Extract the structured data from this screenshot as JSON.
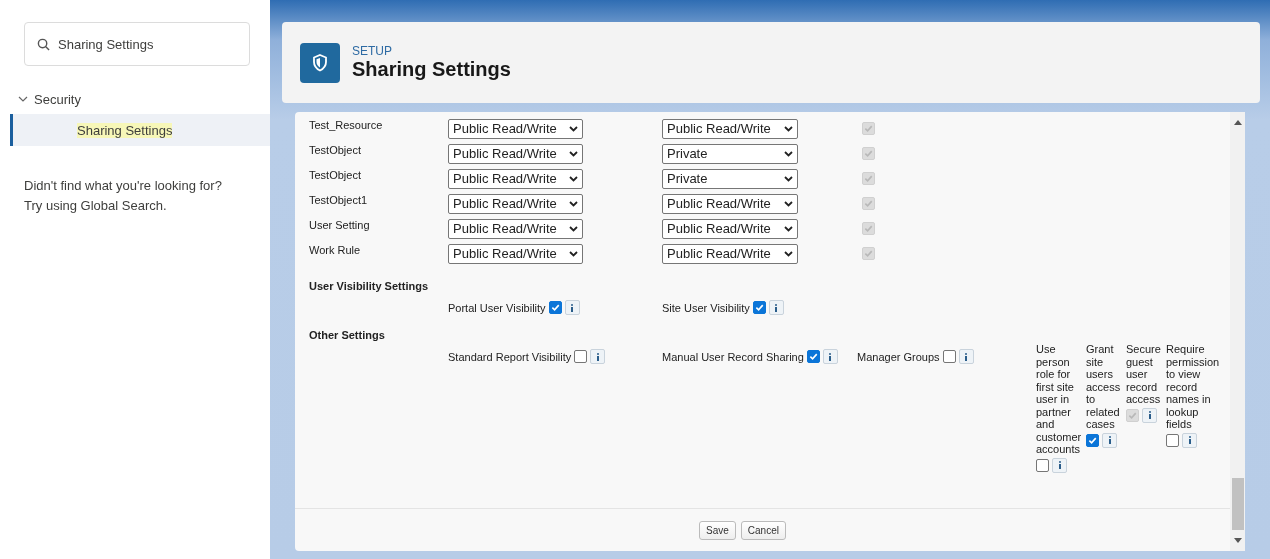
{
  "sidebar": {
    "search": {
      "value": "Sharing Settings"
    },
    "tree": [
      {
        "label": "Security",
        "expanded": true,
        "children": [
          {
            "label": "Sharing Settings",
            "selected": true
          }
        ]
      }
    ],
    "help_lines": [
      "Didn't find what you're looking for?",
      "Try using Global Search."
    ]
  },
  "header": {
    "eyebrow": "SETUP",
    "title": "Sharing Settings"
  },
  "objects": [
    {
      "name": "Test_Resource",
      "internal": "Public Read/Write",
      "external": "Public Read/Write",
      "hierarchy": {
        "checked": true,
        "disabled": true
      }
    },
    {
      "name": "TestObject",
      "internal": "Public Read/Write",
      "external": "Private",
      "hierarchy": {
        "checked": true,
        "disabled": true
      }
    },
    {
      "name": "TestObject",
      "internal": "Public Read/Write",
      "external": "Private",
      "hierarchy": {
        "checked": true,
        "disabled": true
      }
    },
    {
      "name": "TestObject1",
      "internal": "Public Read/Write",
      "external": "Public Read/Write",
      "hierarchy": {
        "checked": true,
        "disabled": true
      }
    },
    {
      "name": "User Setting",
      "internal": "Public Read/Write",
      "external": "Public Read/Write",
      "hierarchy": {
        "checked": true,
        "disabled": true
      }
    },
    {
      "name": "Work Rule",
      "internal": "Public Read/Write",
      "external": "Public Read/Write",
      "hierarchy": {
        "checked": true,
        "disabled": true
      }
    }
  ],
  "sections": [
    {
      "title": "User Visibility Settings",
      "settings": [
        {
          "kind": "inline",
          "label": "Portal User Visibility",
          "checked": true,
          "disabled": false
        },
        {
          "kind": "inline",
          "label": "Site User Visibility",
          "checked": true,
          "disabled": false
        }
      ]
    },
    {
      "title": "Other Settings",
      "settings": [
        {
          "kind": "inline",
          "label": "Standard Report Visibility",
          "checked": false,
          "disabled": false
        },
        {
          "kind": "inline",
          "label": "Manual User Record Sharing",
          "checked": true,
          "disabled": false
        },
        {
          "kind": "inline",
          "label": "Manager Groups",
          "checked": false,
          "disabled": false
        },
        {
          "kind": "stacked",
          "label": "Use person role for first site user in partner and customer accounts",
          "checked": false,
          "disabled": false
        },
        {
          "kind": "stacked",
          "label": "Grant site users access to related cases",
          "checked": true,
          "disabled": false
        },
        {
          "kind": "stacked",
          "label": "Secure guest user record access",
          "checked": true,
          "disabled": true
        },
        {
          "kind": "stacked",
          "label": "Require permission to view record names in lookup fields",
          "checked": false,
          "disabled": false
        }
      ]
    }
  ],
  "buttons": [
    "Save",
    "Cancel"
  ]
}
